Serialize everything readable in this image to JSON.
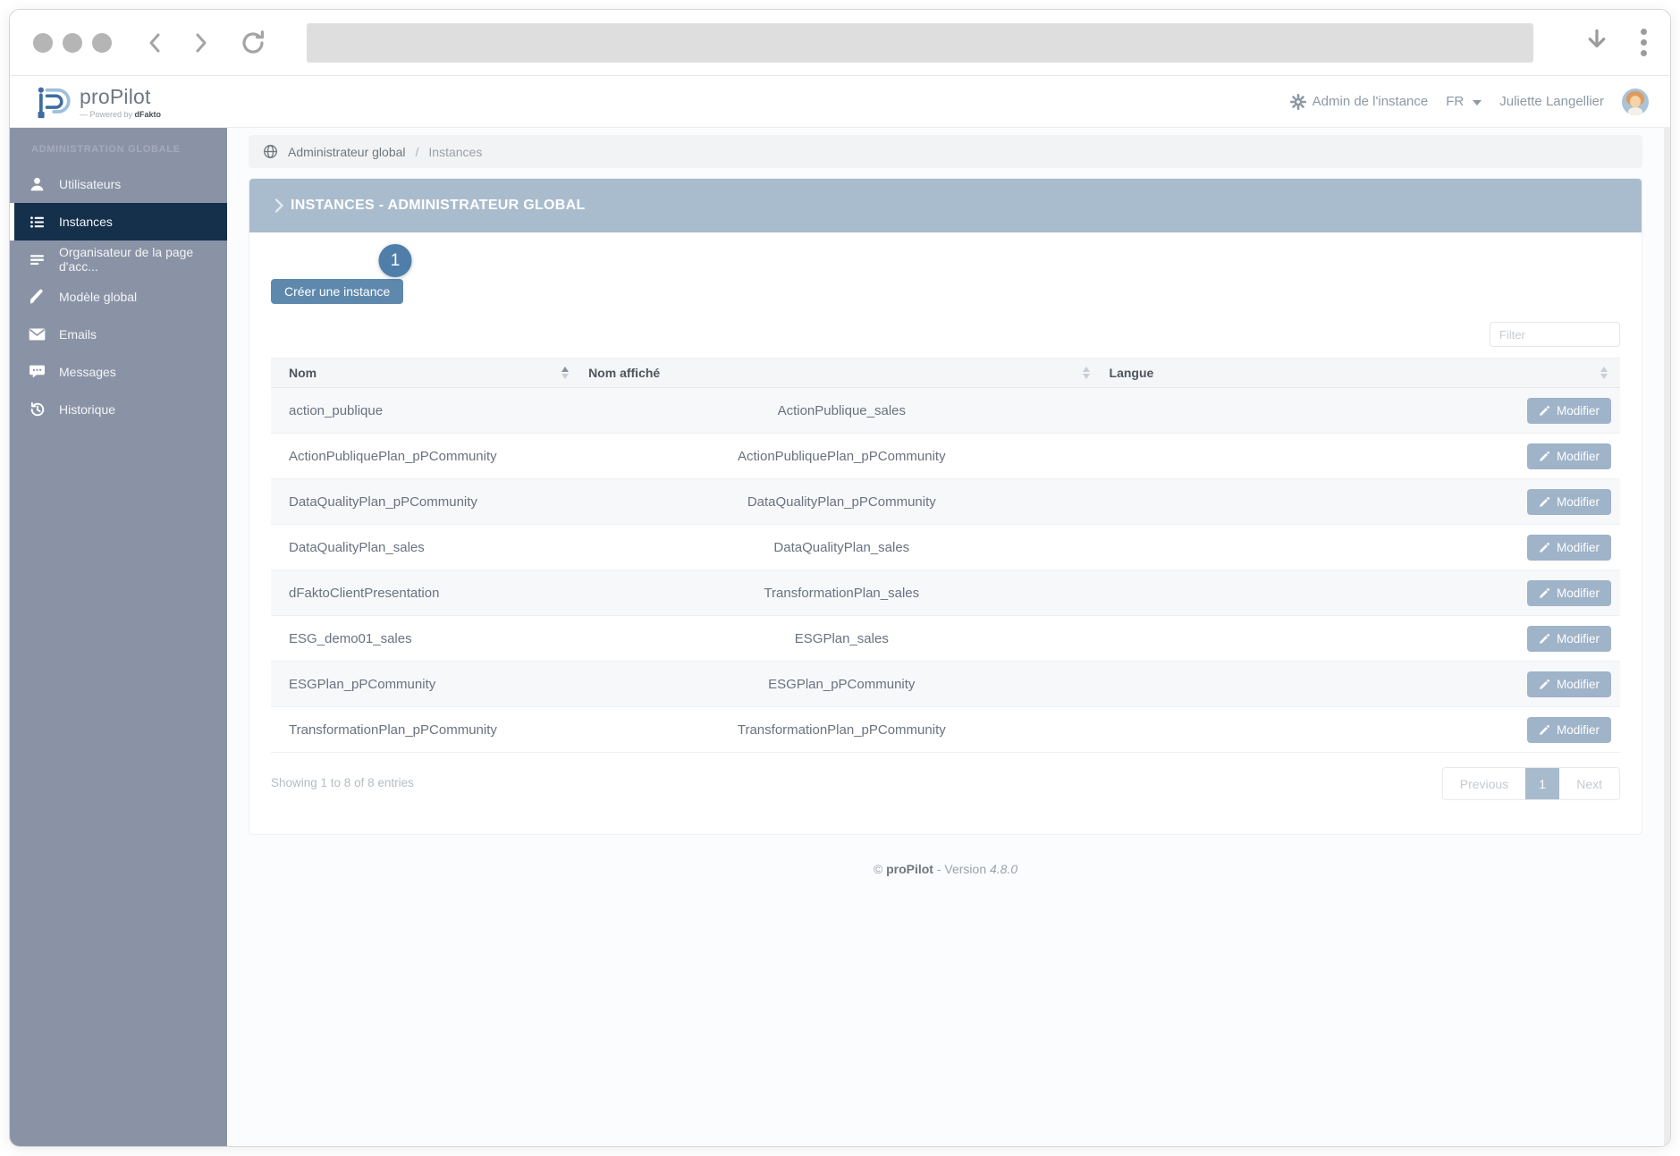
{
  "browser": {
    "address_value": ""
  },
  "header": {
    "brand": "proPilot",
    "tagline_prefix": "—  Powered by ",
    "tagline_brand": "dFakto",
    "admin_label": "Admin de l'instance",
    "language": "FR",
    "user_name": "Juliette Langellier"
  },
  "sidebar": {
    "section_title": "ADMINISTRATION GLOBALE",
    "items": [
      {
        "label": "Utilisateurs",
        "icon": "user",
        "active": false
      },
      {
        "label": "Instances",
        "icon": "list",
        "active": true
      },
      {
        "label": "Organisateur de la page d'acc...",
        "icon": "bars",
        "active": false
      },
      {
        "label": "Modèle global",
        "icon": "brush",
        "active": false
      },
      {
        "label": "Emails",
        "icon": "envelope",
        "active": false
      },
      {
        "label": "Messages",
        "icon": "chat",
        "active": false
      },
      {
        "label": "Historique",
        "icon": "history",
        "active": false
      }
    ]
  },
  "breadcrumb": {
    "root": "Administrateur global",
    "separator": "/",
    "current": "Instances"
  },
  "panel": {
    "title": "INSTANCES - ADMINISTRATEUR GLOBAL",
    "annotation_badge": "1",
    "create_button": "Créer une instance",
    "filter_placeholder": "Filter"
  },
  "table": {
    "columns": [
      "Nom",
      "Nom affiché",
      "Langue"
    ],
    "sorted_column": "Nom",
    "action_label": "Modifier",
    "rows": [
      {
        "nom": "action_publique",
        "affiche": "ActionPublique_sales",
        "langue": ""
      },
      {
        "nom": "ActionPubliquePlan_pPCommunity",
        "affiche": "ActionPubliquePlan_pPCommunity",
        "langue": ""
      },
      {
        "nom": "DataQualityPlan_pPCommunity",
        "affiche": "DataQualityPlan_pPCommunity",
        "langue": ""
      },
      {
        "nom": "DataQualityPlan_sales",
        "affiche": "DataQualityPlan_sales",
        "langue": ""
      },
      {
        "nom": "dFaktoClientPresentation",
        "affiche": "TransformationPlan_sales",
        "langue": ""
      },
      {
        "nom": "ESG_demo01_sales",
        "affiche": "ESGPlan_sales",
        "langue": ""
      },
      {
        "nom": "ESGPlan_pPCommunity",
        "affiche": "ESGPlan_pPCommunity",
        "langue": ""
      },
      {
        "nom": "TransformationPlan_pPCommunity",
        "affiche": "TransformationPlan_pPCommunity",
        "langue": ""
      }
    ],
    "summary": "Showing 1 to 8 of 8 entries"
  },
  "pagination": {
    "previous": "Previous",
    "page": "1",
    "next": "Next"
  },
  "footer": {
    "copyright": "©",
    "brand": "proPilot",
    "separator": " - ",
    "version_label": "Version",
    "version": "4.8.0"
  },
  "colors": {
    "sidebar": "#8a93a6",
    "sidebar_active": "#15304b",
    "panel_header": "#a9bccd",
    "primary_button": "#5e89ad",
    "modifier_button": "#9fb3c9",
    "annotation_badge": "#4e7ea9",
    "pagination_active": "#a7bbcd"
  }
}
